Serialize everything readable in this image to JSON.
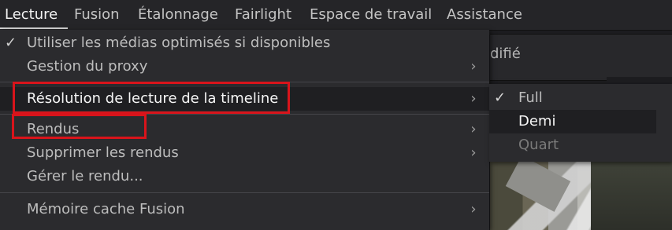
{
  "menubar": {
    "items": [
      {
        "label": "Lecture",
        "active": true
      },
      {
        "label": "Fusion"
      },
      {
        "label": "Étalonnage"
      },
      {
        "label": "Fairlight"
      },
      {
        "label": "Espace de travail"
      },
      {
        "label": "Assistance"
      }
    ]
  },
  "background": {
    "partial_text": "difié"
  },
  "menu": {
    "items": [
      {
        "label": "Utiliser les médias optimisés si disponibles",
        "checked": true
      },
      {
        "label": "Gestion du proxy",
        "submenu": true
      },
      {
        "label": "Résolution de lecture de la timeline",
        "submenu": true,
        "highlighted": true
      },
      {
        "label": "Rendus",
        "submenu": true
      },
      {
        "label": "Supprimer les rendus",
        "submenu": true
      },
      {
        "label": "Gérer le rendu..."
      },
      {
        "label": "Mémoire cache Fusion",
        "submenu": true
      }
    ]
  },
  "submenu": {
    "items": [
      {
        "label": "Full",
        "checked": true
      },
      {
        "label": "Demi",
        "hovered": true
      },
      {
        "label": "Quart",
        "disabled": true
      }
    ]
  },
  "icons": {
    "check": "✓",
    "chevron": "›"
  },
  "colors": {
    "highlight_box": "#d9141b",
    "menu_bg": "#2b2b2e",
    "selected_bg": "#1f1f22"
  }
}
